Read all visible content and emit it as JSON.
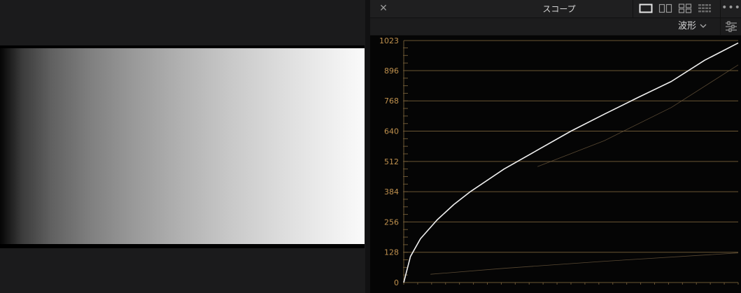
{
  "scope": {
    "title": "スコープ",
    "close_icon": "close-icon",
    "more_icon": "more-icon",
    "mode": "波形",
    "settings_icon": "settings-sliders-icon",
    "layout_buttons": [
      {
        "name": "layout-single-icon",
        "active": true
      },
      {
        "name": "layout-dual-icon",
        "active": false
      },
      {
        "name": "layout-quad-icon",
        "active": false
      },
      {
        "name": "layout-grid-icon",
        "active": false
      }
    ],
    "accent_color": "#c0914e"
  },
  "chart_data": {
    "type": "line",
    "y_ticks": [
      "1023",
      "896",
      "768",
      "640",
      "512",
      "384",
      "256",
      "128",
      "0"
    ],
    "ylim": [
      0,
      1023
    ],
    "xlim": [
      0,
      1
    ],
    "grid": true,
    "series": [
      {
        "color": "#f0f0f0",
        "x": [
          0,
          0.02,
          0.05,
          0.1,
          0.15,
          0.2,
          0.3,
          0.4,
          0.5,
          0.6,
          0.7,
          0.8,
          0.9,
          1.0
        ],
        "y": [
          0,
          110,
          185,
          265,
          330,
          385,
          480,
          560,
          640,
          712,
          782,
          850,
          940,
          1013
        ]
      },
      {
        "color": "#6e5a3e",
        "x": [
          0.4,
          0.6,
          0.8,
          1.0
        ],
        "y": [
          490,
          600,
          740,
          920
        ]
      },
      {
        "color": "#6e5a3e",
        "x": [
          0.08,
          0.3,
          0.6,
          1.0
        ],
        "y": [
          35,
          60,
          90,
          125
        ]
      }
    ]
  }
}
